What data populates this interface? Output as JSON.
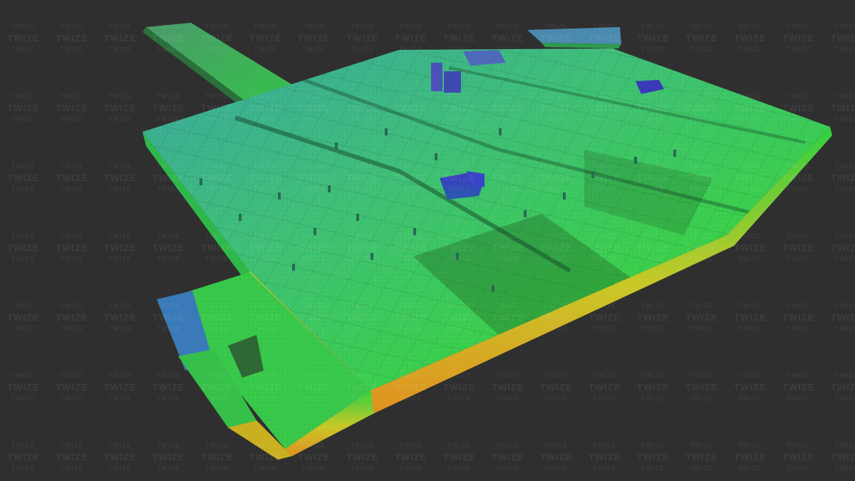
{
  "image": {
    "subject": "lidar-point-cloud-warehouse-roof",
    "watermark_text": "TWIZE",
    "colors": {
      "background": "#2f2f2f",
      "elevation_low": "#e0a020",
      "elevation_mid": "#3fd63f",
      "elevation_high": "#2a2fb0"
    }
  }
}
